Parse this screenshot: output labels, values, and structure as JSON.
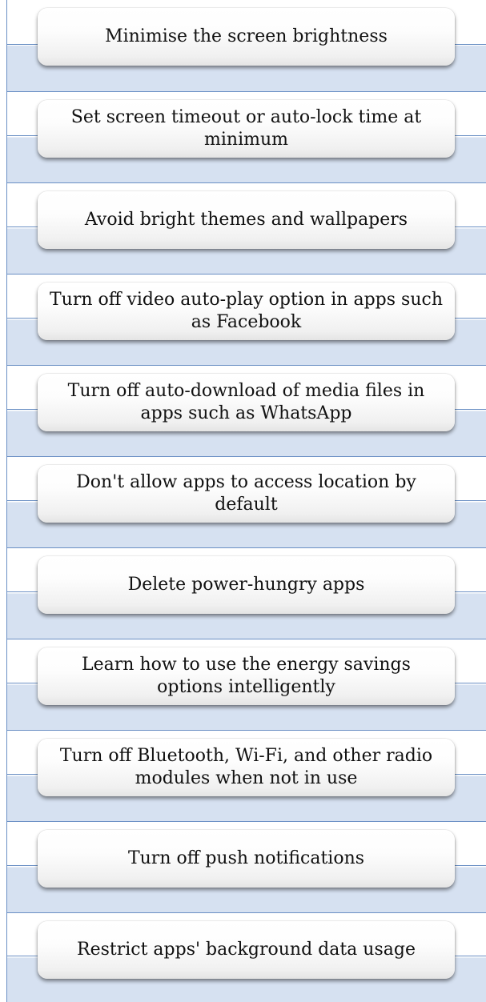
{
  "steps": [
    {
      "label": "Minimise the screen brightness"
    },
    {
      "label": "Set screen timeout or auto-lock time at minimum"
    },
    {
      "label": "Avoid bright themes and wallpapers"
    },
    {
      "label": "Turn off video auto-play option in apps such as Facebook"
    },
    {
      "label": "Turn off auto-download of media files in apps such as WhatsApp"
    },
    {
      "label": "Don't allow apps to access location by default"
    },
    {
      "label": "Delete power-hungry apps"
    },
    {
      "label": "Learn how to use the energy savings options intelligently"
    },
    {
      "label": "Turn off Bluetooth, Wi-Fi, and other radio modules when not in use"
    },
    {
      "label": "Turn off push notifications"
    },
    {
      "label": "Restrict apps' background data usage"
    }
  ]
}
